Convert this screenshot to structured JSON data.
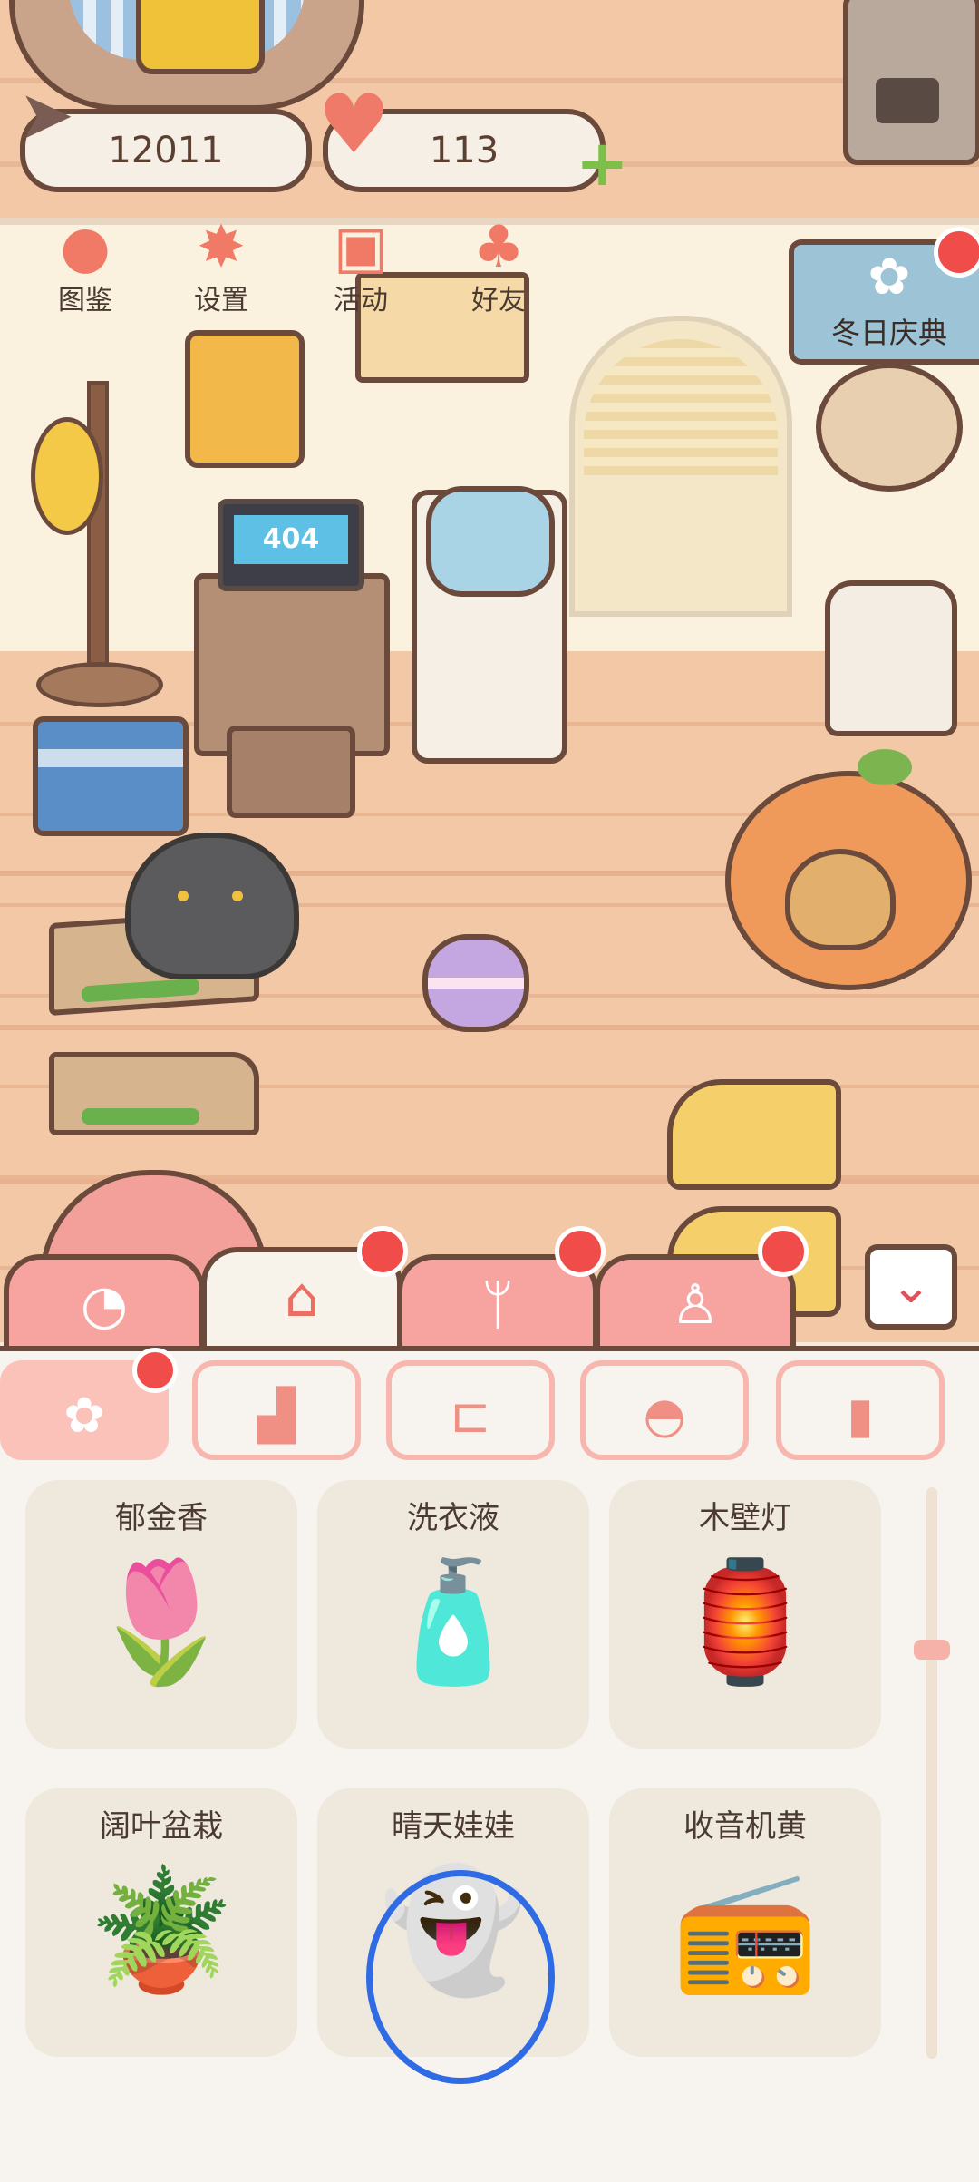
{
  "currency": {
    "fish_count": "12011",
    "heart_count": "113"
  },
  "top_menu": [
    {
      "label": "图鉴",
      "icon": "cat-head-icon"
    },
    {
      "label": "设置",
      "icon": "gear-icon"
    },
    {
      "label": "活动",
      "icon": "gift-icon"
    },
    {
      "label": "好友",
      "icon": "friends-icon"
    }
  ],
  "event_banner": {
    "label": "冬日庆典",
    "icon": "snowflake-flower-icon"
  },
  "scene": {
    "laptop_screen": "404"
  },
  "category_tabs": [
    {
      "name": "cat-face-icon",
      "glyph": "◔",
      "active": false,
      "badge": false
    },
    {
      "name": "house-icon",
      "glyph": "⌂",
      "active": true,
      "badge": true
    },
    {
      "name": "fork-spoon-icon",
      "glyph": "🍴",
      "active": false,
      "badge": true
    },
    {
      "name": "shirt-icon",
      "glyph": "👕",
      "active": false,
      "badge": true
    }
  ],
  "collapse_icon": "chevron-down-icon",
  "sub_tabs": [
    {
      "name": "flower-icon",
      "glyph": "✿",
      "active": true,
      "badge": true
    },
    {
      "name": "sofa-icon",
      "glyph": "🛋",
      "active": false
    },
    {
      "name": "bed-icon",
      "glyph": "🛏",
      "active": false
    },
    {
      "name": "pet-house-icon",
      "glyph": "◓",
      "active": false
    },
    {
      "name": "fridge-icon",
      "glyph": "▮",
      "active": false
    }
  ],
  "items": [
    {
      "label": "郁金香",
      "icon": "tulip-icon",
      "glyph": "🌷"
    },
    {
      "label": "洗衣液",
      "icon": "detergent-icon",
      "glyph": "🧴"
    },
    {
      "label": "木壁灯",
      "icon": "wall-lamp-icon",
      "glyph": "🏮"
    },
    {
      "label": "阔叶盆栽",
      "icon": "potted-plant-icon",
      "glyph": "🪴"
    },
    {
      "label": "晴天娃娃",
      "icon": "teru-teru-bozu-icon",
      "glyph": "👻"
    },
    {
      "label": "收音机黄",
      "icon": "radio-icon",
      "glyph": "📻"
    }
  ],
  "colors": {
    "accent_pink": "#f7a3a0",
    "badge_red": "#f04c4a",
    "selection_ring": "#2f6be4",
    "outline_brown": "#6b4a3c"
  }
}
